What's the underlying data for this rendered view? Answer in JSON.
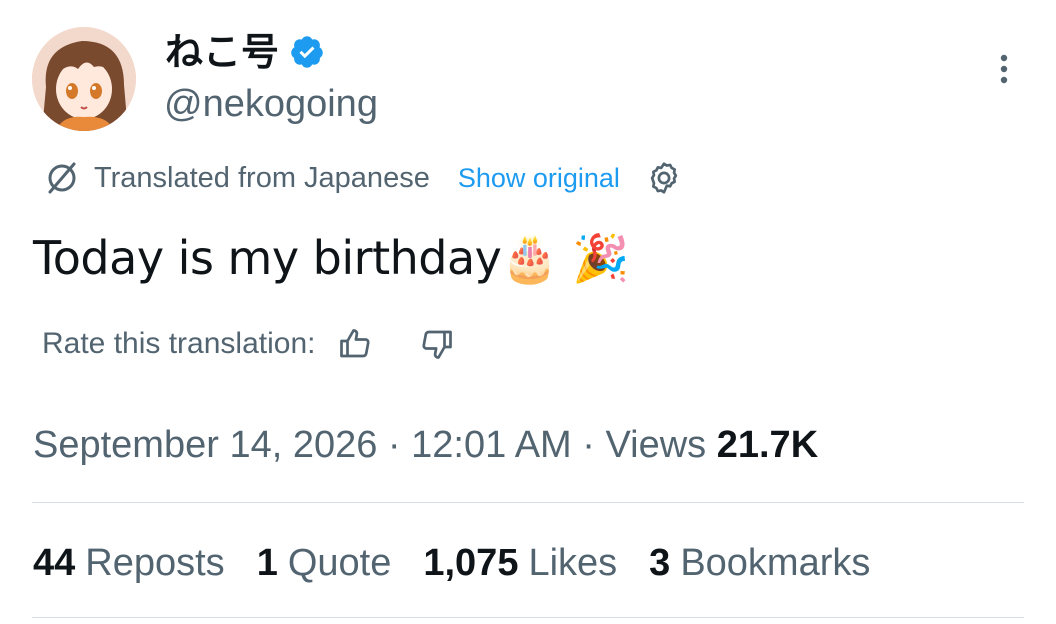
{
  "author": {
    "display_name": "ねこ号",
    "handle": "@nekogoing",
    "verified_color": "#1d9bf0",
    "avatar_icon": "anime-girl-avatar"
  },
  "translation": {
    "label": "Translated from Japanese",
    "show_original": "Show original"
  },
  "tweet": {
    "text": "Today is my birthday🎂 🎉"
  },
  "rating": {
    "label": "Rate this translation:"
  },
  "meta": {
    "date": "September 14, 2026",
    "separator": " · ",
    "time": "12:01 AM",
    "views_label": "Views",
    "views_count": "21.7K"
  },
  "stats": [
    {
      "count": "44",
      "label": "Reposts"
    },
    {
      "count": "1",
      "label": "Quote"
    },
    {
      "count": "1,075",
      "label": "Likes"
    },
    {
      "count": "3",
      "label": "Bookmarks"
    }
  ],
  "colors": {
    "accent": "#1d9bf0",
    "secondary_text": "#536471",
    "primary_text": "#0f1419"
  }
}
